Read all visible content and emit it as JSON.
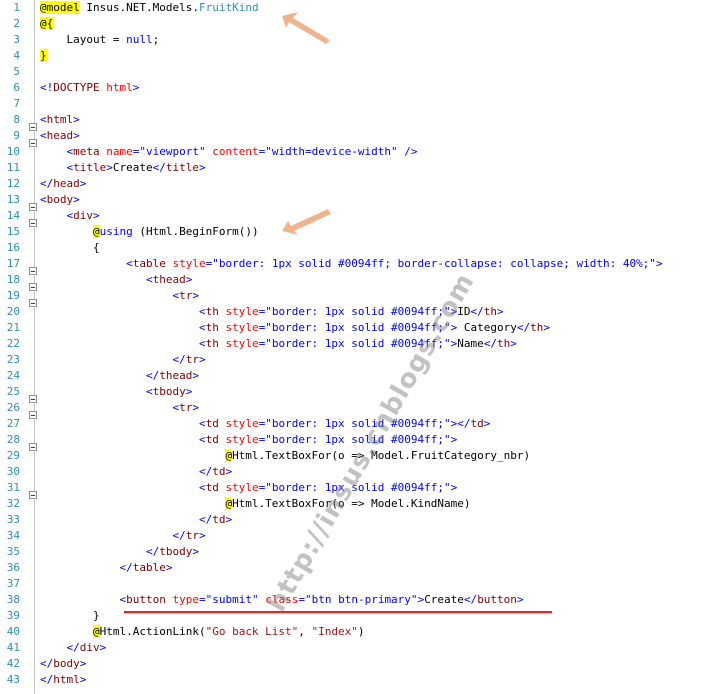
{
  "editor": {
    "watermark": "http://insus.cnblogs.com",
    "lines": [
      {
        "n": "1",
        "y": 0
      },
      {
        "n": "2",
        "y": 1
      },
      {
        "n": "3",
        "y": 2
      },
      {
        "n": "4",
        "y": 3
      },
      {
        "n": "5",
        "y": 4
      },
      {
        "n": "6",
        "y": 5
      },
      {
        "n": "7",
        "y": 6
      },
      {
        "n": "8",
        "y": 7
      },
      {
        "n": "9",
        "y": 8
      },
      {
        "n": "10",
        "y": 9
      },
      {
        "n": "11",
        "y": 10
      },
      {
        "n": "12",
        "y": 11
      },
      {
        "n": "13",
        "y": 12
      },
      {
        "n": "14",
        "y": 13
      },
      {
        "n": "15",
        "y": 14
      },
      {
        "n": "16",
        "y": 15
      },
      {
        "n": "17",
        "y": 16
      },
      {
        "n": "18",
        "y": 17
      },
      {
        "n": "19",
        "y": 18
      },
      {
        "n": "20",
        "y": 19
      },
      {
        "n": "21",
        "y": 20
      },
      {
        "n": "22",
        "y": 21
      },
      {
        "n": "23",
        "y": 22
      },
      {
        "n": "24",
        "y": 23
      },
      {
        "n": "25",
        "y": 24
      },
      {
        "n": "26",
        "y": 25
      },
      {
        "n": "27",
        "y": 26
      },
      {
        "n": "28",
        "y": 27
      },
      {
        "n": "29",
        "y": 28
      },
      {
        "n": "30",
        "y": 29
      },
      {
        "n": "31",
        "y": 30
      },
      {
        "n": "32",
        "y": 31
      },
      {
        "n": "33",
        "y": 32
      },
      {
        "n": "34",
        "y": 33
      },
      {
        "n": "35",
        "y": 34
      },
      {
        "n": "36",
        "y": 35
      },
      {
        "n": "37",
        "y": 36
      },
      {
        "n": "38",
        "y": 37
      },
      {
        "n": "39",
        "y": 38
      },
      {
        "n": "40",
        "y": 39
      },
      {
        "n": "41",
        "y": 40
      },
      {
        "n": "42",
        "y": 41
      },
      {
        "n": "43",
        "y": 42
      }
    ]
  },
  "code": {
    "l1": {
      "at": "@",
      "model": "model",
      "ns": " Insus.NET.Models.",
      "type": "FruitKind"
    },
    "l2": {
      "text": "@{"
    },
    "l3": {
      "indent": "    ",
      "text": "Layout = ",
      "kw": "null",
      "end": ";"
    },
    "l4": {
      "text": "}"
    },
    "l6": {
      "open": "<!",
      "tag": "DOCTYPE",
      "attr": " html",
      "close": ">"
    },
    "l8": {
      "open": "<",
      "tag": "html",
      "close": ">"
    },
    "l9": {
      "open": "<",
      "tag": "head",
      "close": ">"
    },
    "l10": {
      "indent": "    ",
      "open": "<",
      "tag": "meta",
      "a1": " name",
      "eq": "=",
      "v1": "\"viewport\"",
      "a2": " content",
      "v2": "\"width=device-width\"",
      "close": " />"
    },
    "l11": {
      "indent": "    ",
      "open": "<",
      "tag": "title",
      "gt": ">",
      "text": "Create",
      "eopen": "</",
      "etag": "title",
      "close": ">"
    },
    "l12": {
      "open": "</",
      "tag": "head",
      "close": ">"
    },
    "l13": {
      "open": "<",
      "tag": "body",
      "close": ">"
    },
    "l14": {
      "indent": "    ",
      "open": "<",
      "tag": "div",
      "close": ">"
    },
    "l15": {
      "indent": "        ",
      "at": "@",
      "kw": "using",
      "text": " (Html.BeginForm())"
    },
    "l16": {
      "indent": "        ",
      "text": "{"
    },
    "l17": {
      "indent": "             ",
      "open": "<",
      "tag": "table",
      "a1": " style",
      "eq": "=",
      "v1": "\"border: 1px solid #0094ff; border-collapse: collapse; width: 40%;\"",
      "close": ">"
    },
    "l18": {
      "indent": "                ",
      "open": "<",
      "tag": "thead",
      "close": ">"
    },
    "l19": {
      "indent": "                    ",
      "open": "<",
      "tag": "tr",
      "close": ">"
    },
    "l20": {
      "indent": "                        ",
      "open": "<",
      "tag": "th",
      "a1": " style",
      "eq": "=",
      "v1": "\"border: 1px solid #0094ff;\"",
      "gt": ">",
      "text": "ID",
      "eopen": "</",
      "etag": "th",
      "close": ">"
    },
    "l21": {
      "indent": "                        ",
      "open": "<",
      "tag": "th",
      "a1": " style",
      "eq": "=",
      "v1": "\"border: 1px solid #0094ff;\"",
      "gt": ">",
      "text": " Category",
      "eopen": "</",
      "etag": "th",
      "close": ">"
    },
    "l22": {
      "indent": "                        ",
      "open": "<",
      "tag": "th",
      "a1": " style",
      "eq": "=",
      "v1": "\"border: 1px solid #0094ff;\"",
      "gt": ">",
      "text": "Name",
      "eopen": "</",
      "etag": "th",
      "close": ">"
    },
    "l23": {
      "indent": "                    ",
      "open": "</",
      "tag": "tr",
      "close": ">"
    },
    "l24": {
      "indent": "                ",
      "open": "</",
      "tag": "thead",
      "close": ">"
    },
    "l25": {
      "indent": "                ",
      "open": "<",
      "tag": "tbody",
      "close": ">"
    },
    "l26": {
      "indent": "                    ",
      "open": "<",
      "tag": "tr",
      "close": ">"
    },
    "l27": {
      "indent": "                        ",
      "open": "<",
      "tag": "td",
      "a1": " style",
      "eq": "=",
      "v1": "\"border: 1px solid #0094ff;\"",
      "gt": ">",
      "eopen": "</",
      "etag": "td",
      "close": ">"
    },
    "l28": {
      "indent": "                        ",
      "open": "<",
      "tag": "td",
      "a1": " style",
      "eq": "=",
      "v1": "\"border: 1px solid #0094ff;\"",
      "close": ">"
    },
    "l29": {
      "indent": "                            ",
      "at": "@",
      "text": "Html.TextBoxFor(o => Model.FruitCategory_nbr)"
    },
    "l30": {
      "indent": "                        ",
      "open": "</",
      "tag": "td",
      "close": ">"
    },
    "l31": {
      "indent": "                        ",
      "open": "<",
      "tag": "td",
      "a1": " style",
      "eq": "=",
      "v1": "\"border: 1px solid #0094ff;\"",
      "close": ">"
    },
    "l32": {
      "indent": "                            ",
      "at": "@",
      "text": "Html.TextBoxFor(o => Model.KindName)"
    },
    "l33": {
      "indent": "                        ",
      "open": "</",
      "tag": "td",
      "close": ">"
    },
    "l34": {
      "indent": "                    ",
      "open": "</",
      "tag": "tr",
      "close": ">"
    },
    "l35": {
      "indent": "                ",
      "open": "</",
      "tag": "tbody",
      "close": ">"
    },
    "l36": {
      "indent": "            ",
      "open": "</",
      "tag": "table",
      "close": ">"
    },
    "l38": {
      "indent": "            ",
      "open": "<",
      "tag": "button",
      "a1": " type",
      "eq": "=",
      "v1": "\"submit\"",
      "a2": " class",
      "v2": "\"btn btn-primary\"",
      "gt": ">",
      "text": "Create",
      "eopen": "</",
      "etag": "button",
      "close": ">"
    },
    "l39": {
      "indent": "        ",
      "text": "}"
    },
    "l40": {
      "indent": "        ",
      "at": "@",
      "text": "Html.ActionLink(",
      "s1": "\"Go back List\"",
      "comma": ", ",
      "s2": "\"Index\"",
      "end": ")"
    },
    "l41": {
      "indent": "    ",
      "open": "</",
      "tag": "div",
      "close": ">"
    },
    "l42": {
      "open": "</",
      "tag": "body",
      "close": ">"
    },
    "l43": {
      "open": "</",
      "tag": "html",
      "close": ">"
    }
  },
  "colors": {
    "accent": "#0094ff",
    "underline": "#c0392b",
    "arrow": "#f0b48c"
  }
}
